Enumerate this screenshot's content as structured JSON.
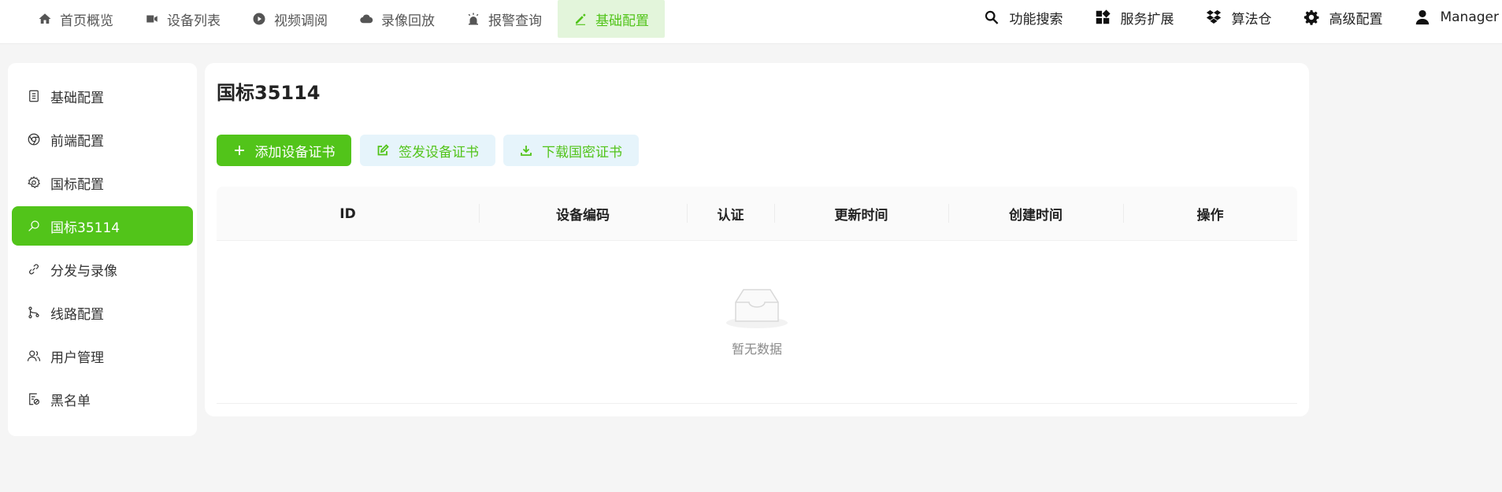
{
  "top_nav": {
    "left": [
      {
        "icon": "home-icon",
        "label": "首页概览"
      },
      {
        "icon": "video-camera-icon",
        "label": "设备列表"
      },
      {
        "icon": "play-circle-icon",
        "label": "视频调阅"
      },
      {
        "icon": "cloud-icon",
        "label": "录像回放"
      },
      {
        "icon": "alarm-icon",
        "label": "报警查询"
      },
      {
        "icon": "edit-pen-icon",
        "label": "基础配置",
        "active": true
      }
    ],
    "right": [
      {
        "icon": "search-icon",
        "label": "功能搜索"
      },
      {
        "icon": "widgets-icon",
        "label": "服务扩展"
      },
      {
        "icon": "dropbox-icon",
        "label": "算法仓"
      },
      {
        "icon": "gear-icon",
        "label": "高级配置"
      },
      {
        "icon": "user-icon",
        "label": "Manager"
      }
    ]
  },
  "sidebar": {
    "items": [
      {
        "icon": "config-list-icon",
        "label": "基础配置"
      },
      {
        "icon": "chrome-icon",
        "label": "前端配置"
      },
      {
        "icon": "settings-icon",
        "label": "国标配置"
      },
      {
        "icon": "search-key-icon",
        "label": "国标35114",
        "active": true
      },
      {
        "icon": "link-icon",
        "label": "分发与录像"
      },
      {
        "icon": "branch-icon",
        "label": "线路配置"
      },
      {
        "icon": "users-icon",
        "label": "用户管理"
      },
      {
        "icon": "blacklist-icon",
        "label": "黑名单"
      }
    ]
  },
  "main": {
    "title": "国标35114",
    "buttons": {
      "add": "添加设备证书",
      "sign": "签发设备证书",
      "download": "下载国密证书"
    },
    "table": {
      "columns": [
        "ID",
        "设备编码",
        "认证",
        "更新时间",
        "创建时间",
        "操作"
      ],
      "rows": [],
      "empty_text": "暂无数据"
    }
  },
  "colors": {
    "accent": "#52c41a",
    "accent_light": "#e3f5db",
    "button_light": "#e6f4fb",
    "background": "#f5f5f5"
  }
}
